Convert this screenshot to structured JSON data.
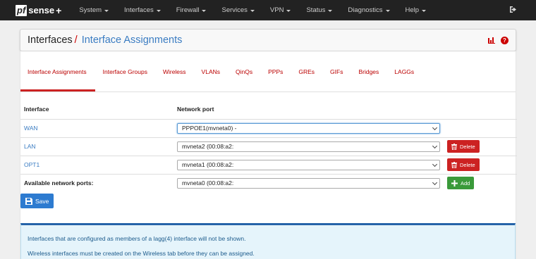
{
  "logo": {
    "pf": "pf",
    "sense": "sense",
    "plus": "+"
  },
  "nav": [
    {
      "label": "System"
    },
    {
      "label": "Interfaces"
    },
    {
      "label": "Firewall"
    },
    {
      "label": "Services"
    },
    {
      "label": "VPN"
    },
    {
      "label": "Status"
    },
    {
      "label": "Diagnostics"
    },
    {
      "label": "Help"
    }
  ],
  "breadcrumb": {
    "section": "Interfaces",
    "separator": "/",
    "page": "Interface Assignments"
  },
  "tabs": [
    "Interface Assignments",
    "Interface Groups",
    "Wireless",
    "VLANs",
    "QinQs",
    "PPPs",
    "GREs",
    "GIFs",
    "Bridges",
    "LAGGs"
  ],
  "table": {
    "headers": {
      "interface": "Interface",
      "port": "Network port"
    },
    "rows": [
      {
        "name": "WAN",
        "port": "PPPOE1(mvneta0) -",
        "action": ""
      },
      {
        "name": "LAN",
        "port": "mvneta2 (00:08:a2:",
        "action": "Delete"
      },
      {
        "name": "OPT1",
        "port": "mvneta1 (00:08:a2:",
        "action": "Delete"
      }
    ],
    "available": {
      "label": "Available network ports:",
      "port": "mvneta0 (00:08:a2:",
      "action": "Add"
    }
  },
  "save_label": "Save",
  "info": {
    "line1": "Interfaces that are configured as members of a lagg(4) interface will not be shown.",
    "line2": "Wireless interfaces must be created on the Wireless tab before they can be assigned."
  },
  "colors": {
    "accent": "#c22222",
    "link": "#3a7cc2",
    "navbar": "#222222",
    "save": "#2d7bd0",
    "add": "#3a9a3a"
  }
}
